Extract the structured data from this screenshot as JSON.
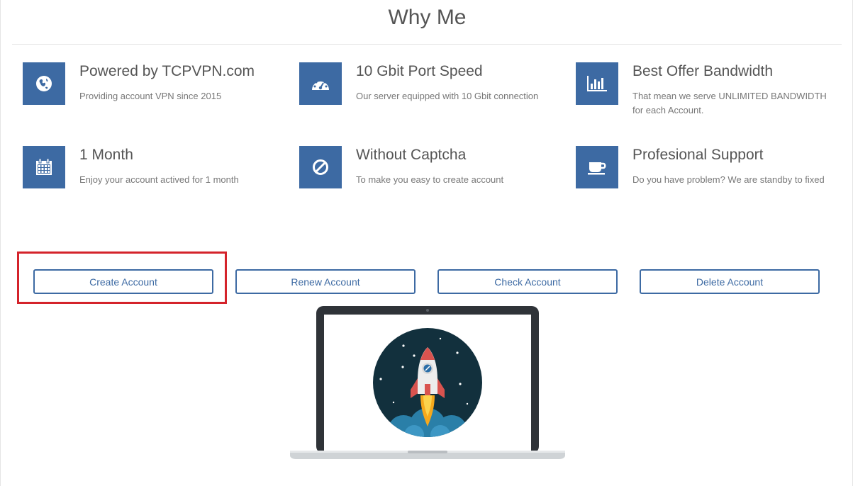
{
  "section": {
    "title": "Why Me"
  },
  "features": [
    {
      "icon": "globe-icon",
      "title": "Powered by TCPVPN.com",
      "description": "Providing account VPN since 2015"
    },
    {
      "icon": "speedometer-icon",
      "title": "10 Gbit Port Speed",
      "description": "Our server equipped with 10 Gbit connection"
    },
    {
      "icon": "bar-chart-icon",
      "title": "Best Offer Bandwidth",
      "description": "That mean we serve UNLIMITED BANDWIDTH for each Account."
    },
    {
      "icon": "calendar-icon",
      "title": "1 Month",
      "description": "Enjoy your account actived for 1 month"
    },
    {
      "icon": "ban-icon",
      "title": "Without Captcha",
      "description": "To make you easy to create account"
    },
    {
      "icon": "coffee-cup-icon",
      "title": "Profesional Support",
      "description": "Do you have problem? We are standby to fixed"
    }
  ],
  "actions": {
    "create": "Create Account",
    "renew": "Renew Account",
    "check": "Check Account",
    "delete": "Delete Account"
  },
  "highlight": {
    "target": "create-account-button",
    "color": "#d4232b"
  },
  "illustration": {
    "name": "laptop-rocket-illustration"
  },
  "colors": {
    "accent": "#3d6aa3",
    "title_text": "#555555",
    "body_text": "#777777",
    "rocket_bg": "#12303d"
  }
}
